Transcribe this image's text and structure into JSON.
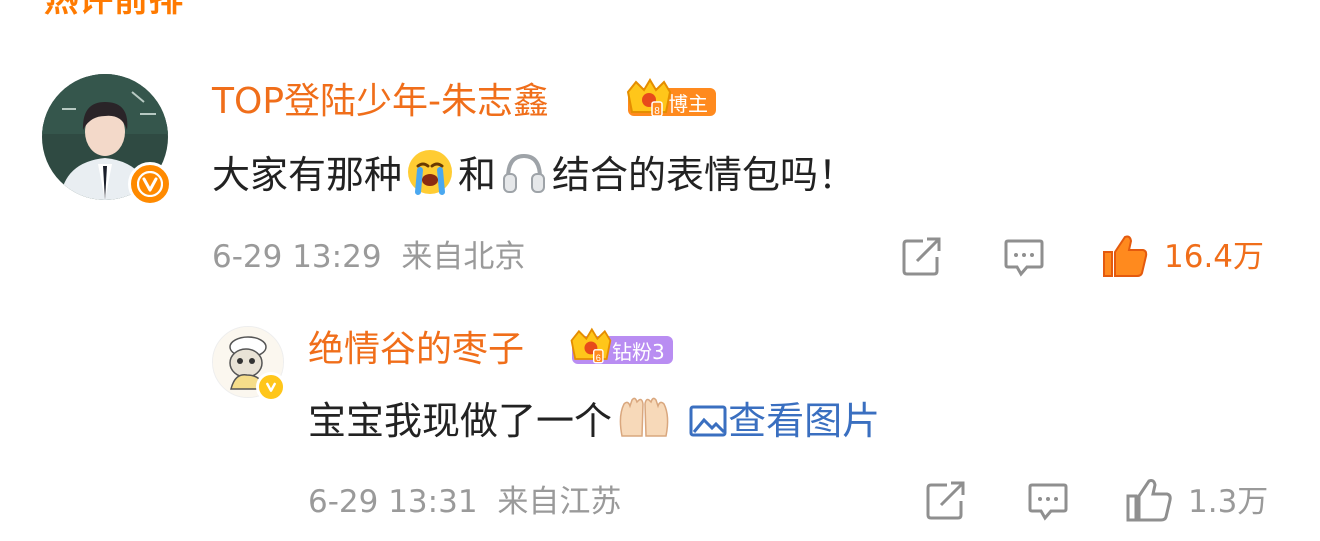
{
  "section": {
    "title": "热评前排"
  },
  "colors": {
    "accent": "#f06e1a",
    "like_active": "#f06e1a",
    "meta": "#9a9a9a",
    "link": "#3a6fc0",
    "fan_tag": "#b98df2"
  },
  "comments": [
    {
      "author": "TOP登陆少年-朱志鑫",
      "tag_label": "博主",
      "text_part1": "大家有那种",
      "emoji1": "loudly-crying-emoji",
      "text_part2": "和",
      "emoji2": "headphones-emoji",
      "text_part3": "结合的表情包吗！",
      "timestamp": "6-29 13:29",
      "location": "来自北京",
      "like_count": "16.4万",
      "liked": true
    },
    {
      "author": "绝情谷的枣子",
      "tag_label": "钻粉3",
      "text": "宝宝我现做了一个",
      "emoji": "palms-up-together-emoji",
      "image_link": "查看图片",
      "timestamp": "6-29 13:31",
      "location": "来自江苏",
      "like_count": "1.3万",
      "liked": false
    }
  ]
}
